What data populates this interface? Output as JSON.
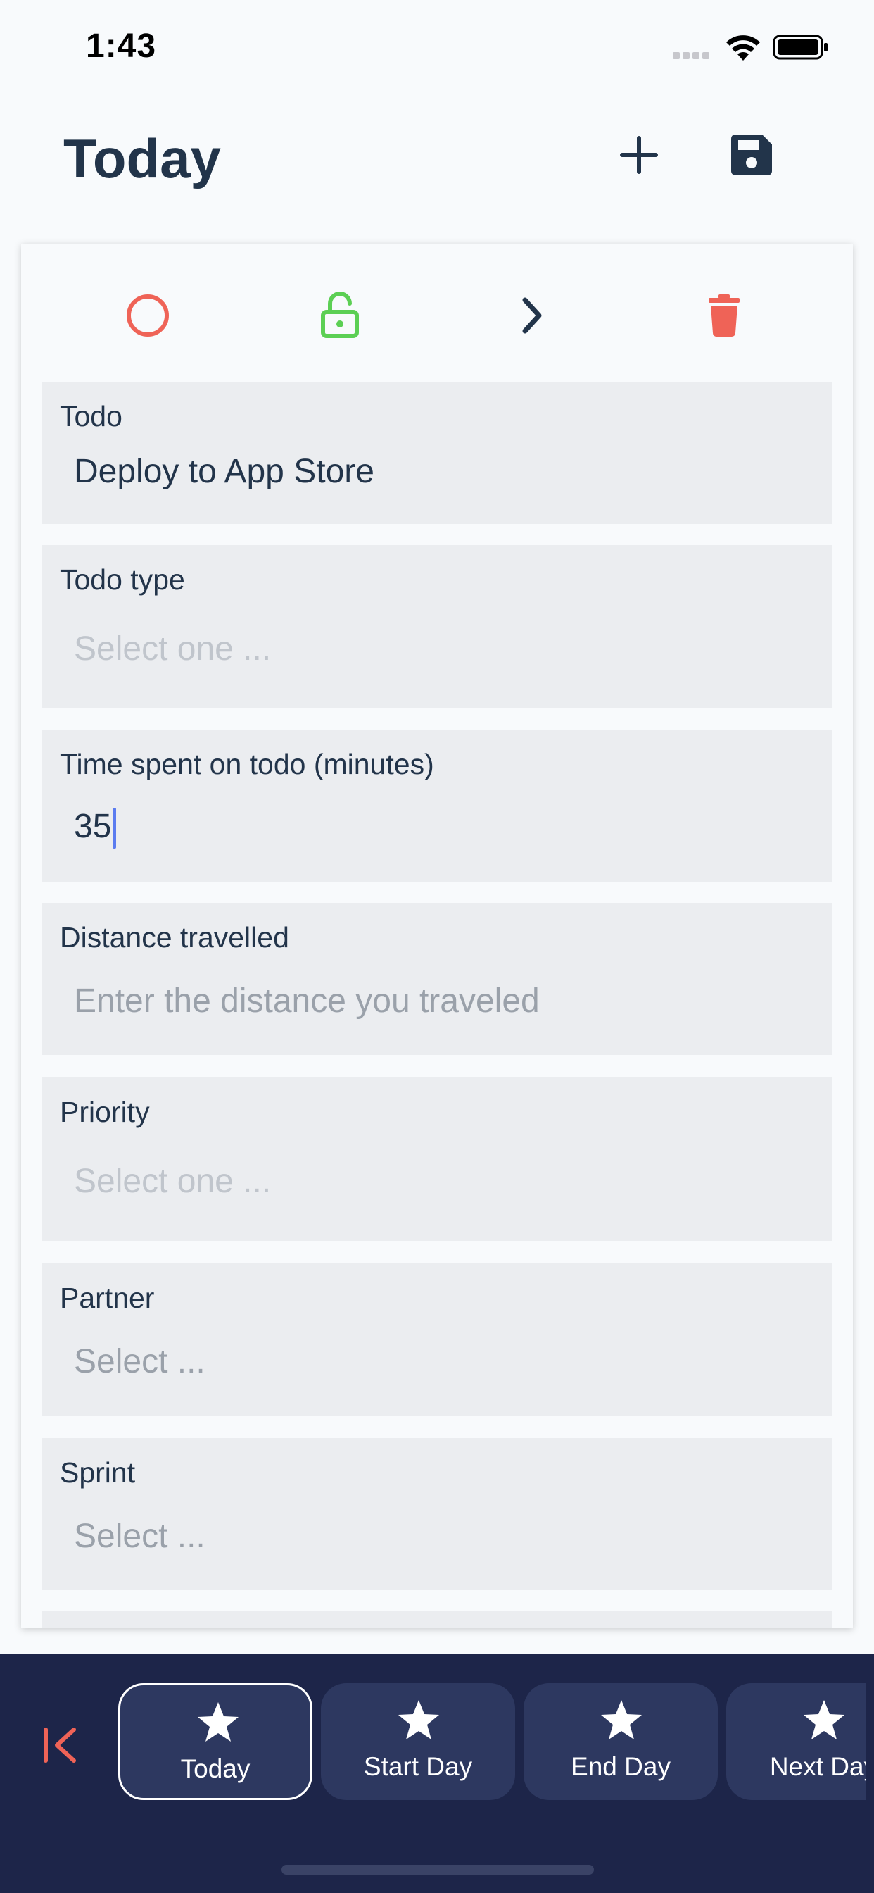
{
  "status_bar": {
    "time": "1:43"
  },
  "header": {
    "title": "Today"
  },
  "actions": {
    "complete_icon": "circle-icon",
    "lock_icon": "unlocked-lock-icon",
    "next_icon": "chevron-right-icon",
    "delete_icon": "trash-icon"
  },
  "form": {
    "todo": {
      "label": "Todo",
      "value": "Deploy to App Store"
    },
    "todo_type": {
      "label": "Todo type",
      "placeholder": "Select one ..."
    },
    "time_spent": {
      "label": "Time spent on todo (minutes)",
      "value": "35"
    },
    "distance": {
      "label": "Distance travelled",
      "placeholder": "Enter the distance you traveled"
    },
    "priority": {
      "label": "Priority",
      "placeholder": "Select one ..."
    },
    "partner": {
      "label": "Partner",
      "placeholder": "Select ..."
    },
    "sprint": {
      "label": "Sprint",
      "placeholder": "Select ..."
    }
  },
  "bottom_nav": {
    "tabs": [
      {
        "label": "Today"
      },
      {
        "label": "Start Day"
      },
      {
        "label": "End Day"
      },
      {
        "label": "Next Day"
      }
    ]
  },
  "colors": {
    "accent_red": "#ef6357",
    "accent_green": "#5ccf54",
    "navy": "#1d2549",
    "text_dark": "#22344a"
  }
}
